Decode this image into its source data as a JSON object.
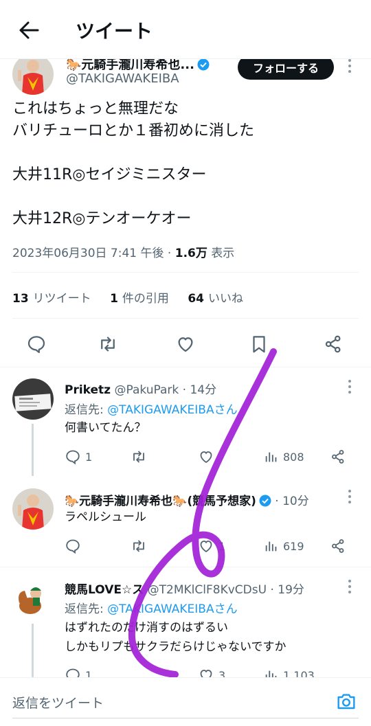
{
  "header": {
    "title": "ツイート"
  },
  "author": {
    "name": "🐎元騎手瀧川寿希也...",
    "handle": "@TAKIGAWAKEIBA",
    "follow_label": "フォローする"
  },
  "tweet": {
    "text": "これはちょっと無理だな\nバリチューロとか１番初めに消した\n\n大井11R◎セイジミニスター\n\n大井12R◎テンオーケオー",
    "datetime": "2023年06月30日 7:41 午後",
    "dot": " · ",
    "views_count": "1.6万",
    "views_label": " 表示",
    "retweets": {
      "count": "13",
      "label": "リツイート"
    },
    "quotes": {
      "count": "1",
      "label": "件の引用"
    },
    "likes": {
      "count": "64",
      "label": "いいね"
    }
  },
  "replies": [
    {
      "name": "Priketz",
      "handle": "@PakuPark",
      "time": " · 14分",
      "reply_prefix": "返信先: ",
      "reply_to": "@TAKIGAWAKEIBAさん",
      "text": "何書いてたん？",
      "reply_count": "1",
      "retweet_count": "",
      "like_count": "",
      "view_count": "808"
    },
    {
      "name": "🐎元騎手瀧川寿希也🐎(競馬予想家)",
      "handle": "",
      "time": " · 10分",
      "text": "ラペルシュール",
      "reply_count": "",
      "retweet_count": "",
      "like_count": "1",
      "view_count": "619"
    },
    {
      "name": "競馬LOVE☆ス",
      "handle": "@T2MKlClF8KvCDsU",
      "time": " · 19分",
      "reply_prefix": "返信先: ",
      "reply_to": "@TAKIGAWAKEIBAさん",
      "text": "はずれたのだけ消すのはずるい\nしかもリプもサクラだらけじゃないですか",
      "reply_count": "1",
      "like_count": "3",
      "view_count": "1,103"
    }
  ],
  "composer": {
    "placeholder": "返信をツイート"
  },
  "colors": {
    "accent": "#1d9bf0",
    "scribble": "#a21fd6",
    "text": "#0f1419",
    "muted": "#536471"
  },
  "icons": [
    "back-arrow-icon",
    "verified-badge-icon",
    "more-icon",
    "reply-icon",
    "retweet-icon",
    "like-icon",
    "bookmark-icon",
    "share-icon",
    "views-icon",
    "camera-icon"
  ]
}
